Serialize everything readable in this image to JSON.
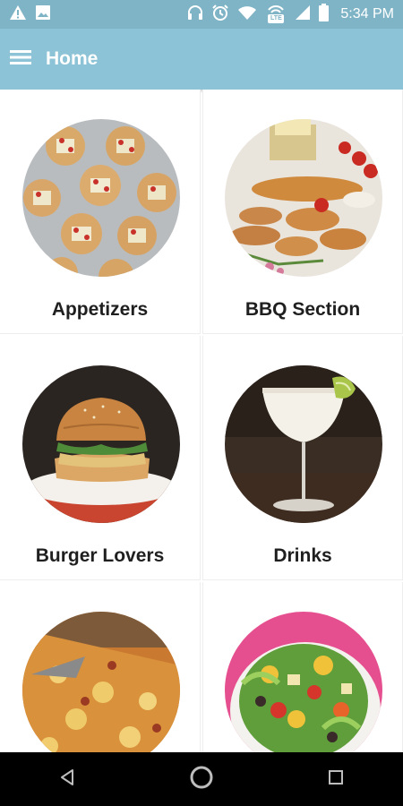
{
  "status_bar": {
    "time": "5:34 PM",
    "network_badge": "LTE",
    "icons": [
      "warning-icon",
      "image-icon",
      "headphones-icon",
      "alarm-icon",
      "wifi-icon",
      "volte-icon",
      "signal-icon",
      "battery-icon"
    ]
  },
  "app_bar": {
    "title": "Home",
    "menu_icon": "hamburger-menu-icon"
  },
  "categories": [
    {
      "label": "Appetizers"
    },
    {
      "label": "BBQ Section"
    },
    {
      "label": "Burger Lovers"
    },
    {
      "label": "Drinks"
    },
    {
      "label": ""
    },
    {
      "label": ""
    }
  ],
  "nav_bar": {
    "icons": [
      "back-icon",
      "home-icon",
      "recents-icon"
    ]
  },
  "colors": {
    "status_bar": "#7fb4c6",
    "app_bar": "#8dc3d6",
    "label_text": "#1f1f1f",
    "nav_bar": "#000000"
  }
}
